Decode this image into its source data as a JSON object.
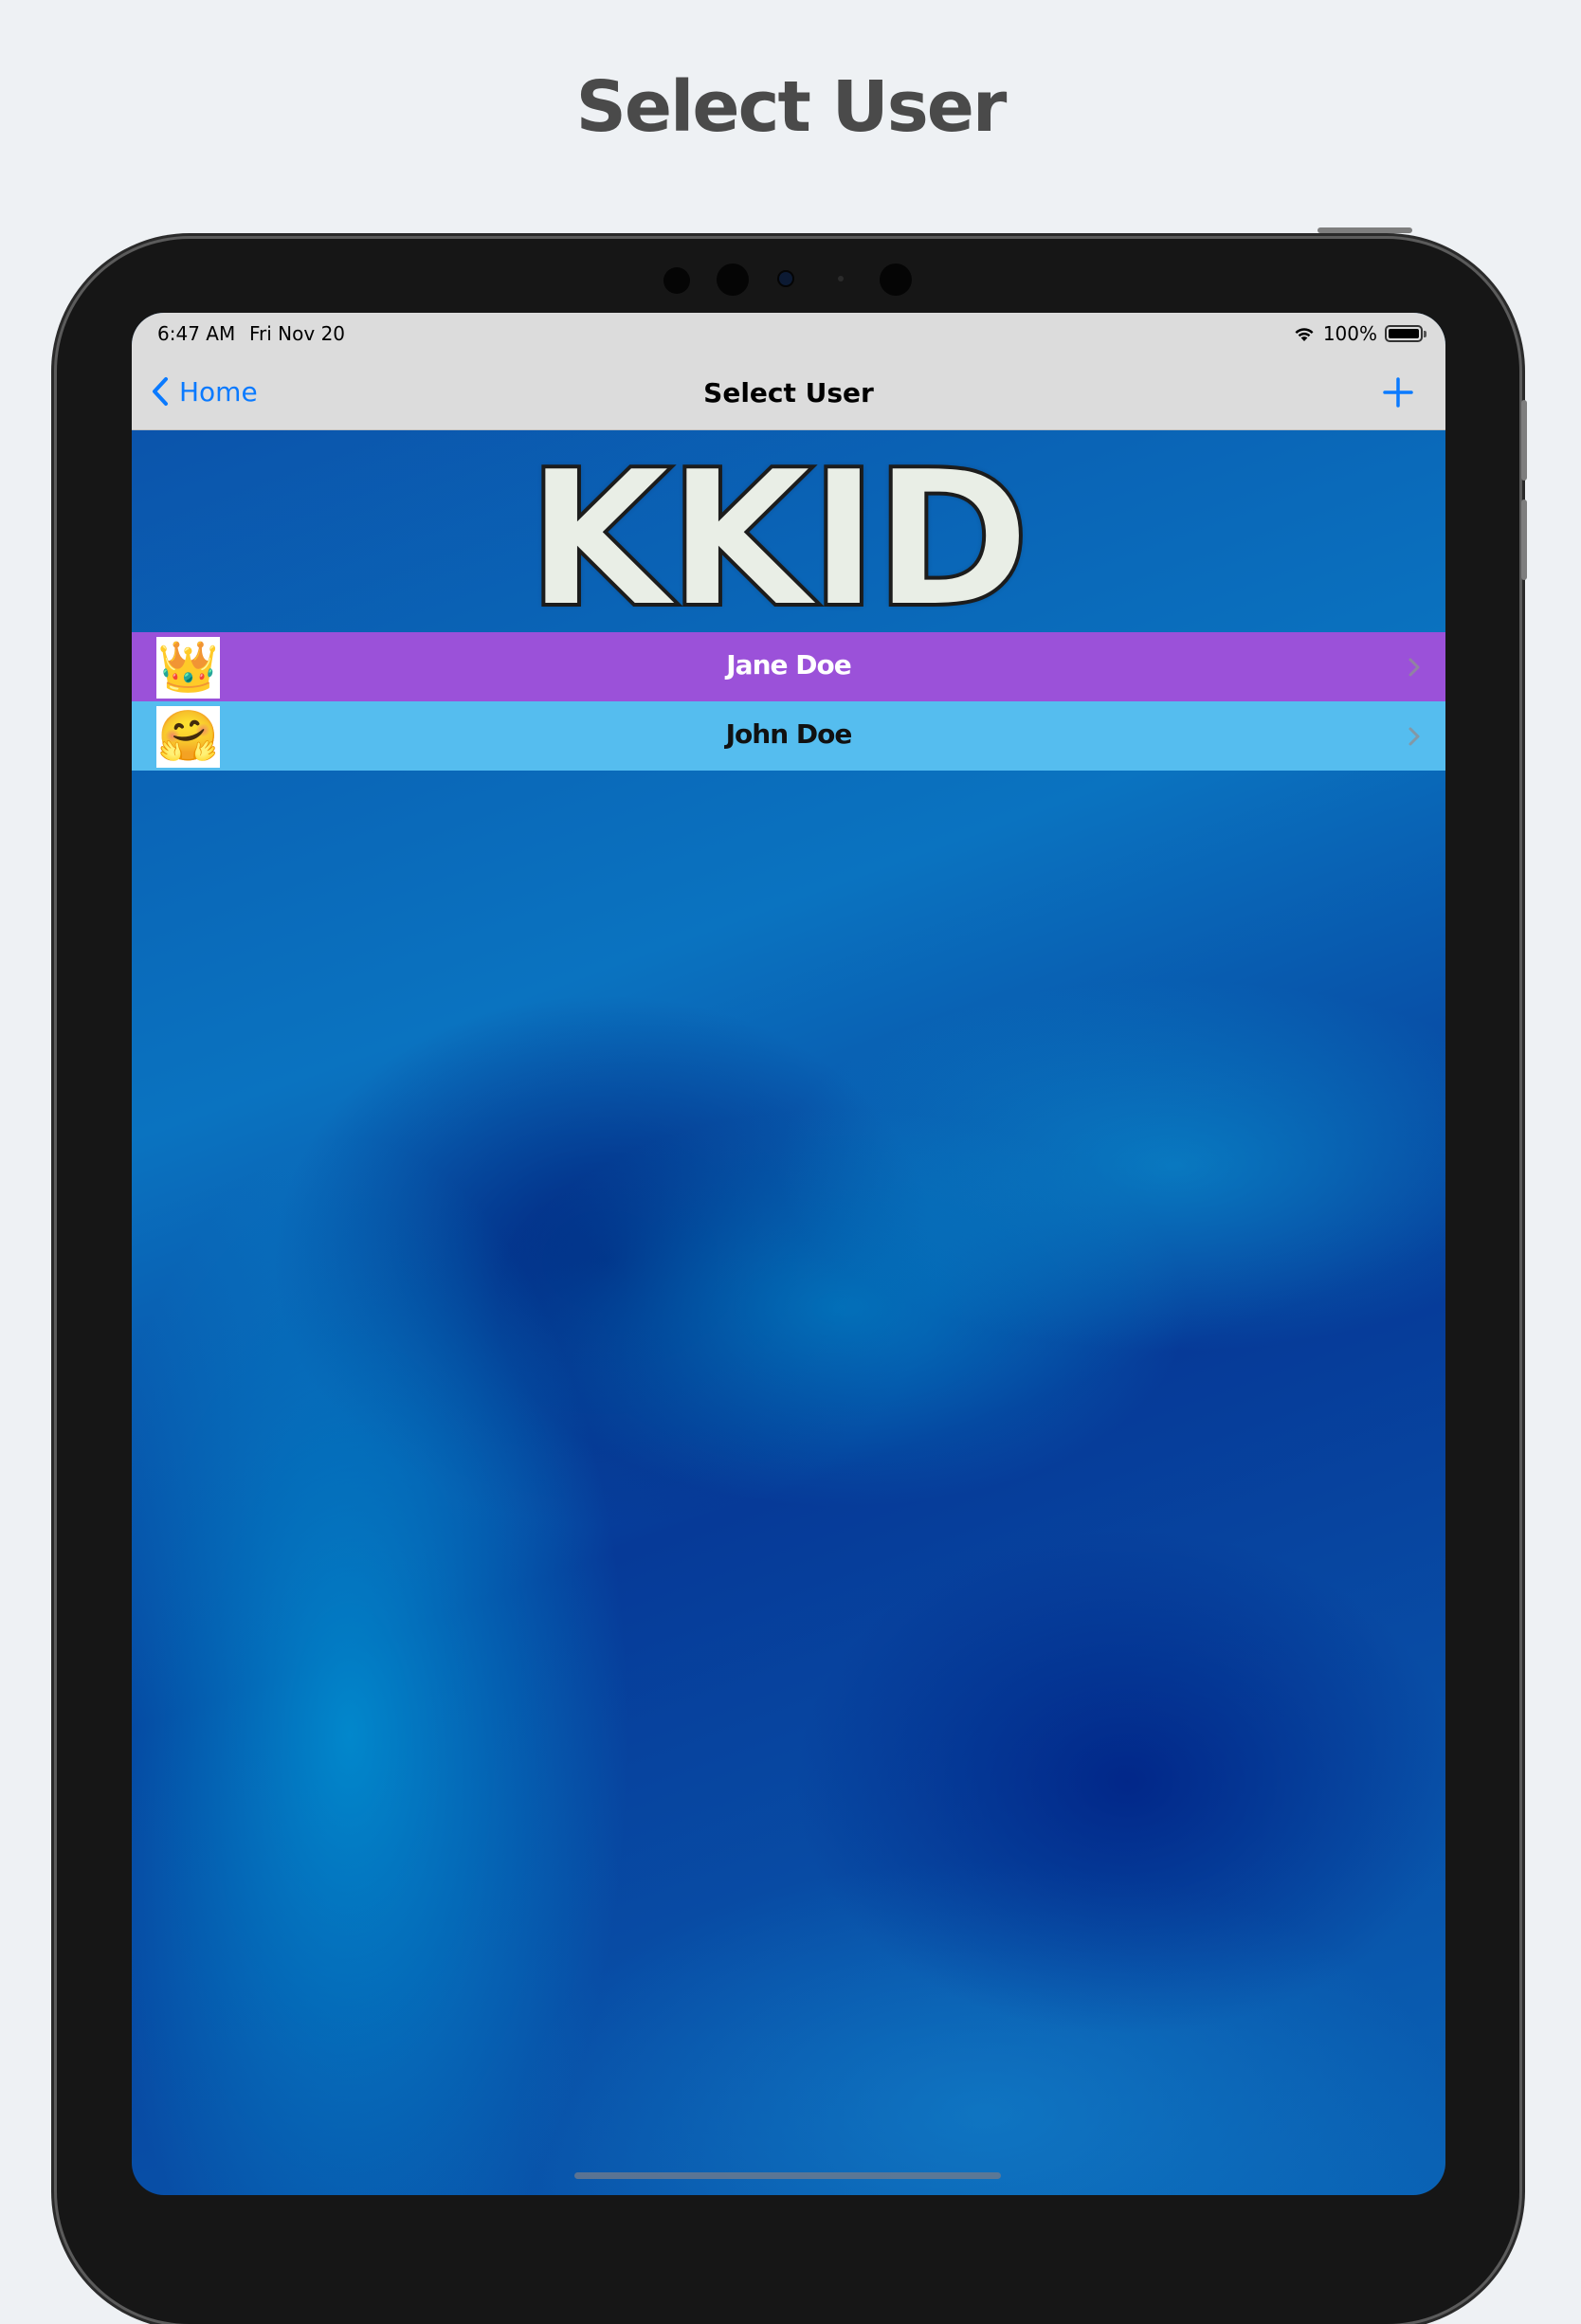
{
  "page_caption": "Select User",
  "status_bar": {
    "time": "6:47 AM",
    "date": "Fri Nov 20",
    "battery": "100%",
    "battery_level": 1.0,
    "wifi_icon": "wifi-icon"
  },
  "nav": {
    "back_label": "Home",
    "title": "Select User",
    "add_icon": "plus-icon",
    "accent": "#0a7aff"
  },
  "banner": {
    "logo_text": "KKID"
  },
  "users": [
    {
      "name": "Jane Doe",
      "avatar": "👑",
      "avatar_icon": "crown-icon",
      "row_color": "#9b51d9",
      "text_color": "#ffffff"
    },
    {
      "name": "John Doe",
      "avatar": "🤗",
      "avatar_icon": "hugging-face-icon",
      "row_color": "#55bdef",
      "text_color": "#111111"
    }
  ]
}
